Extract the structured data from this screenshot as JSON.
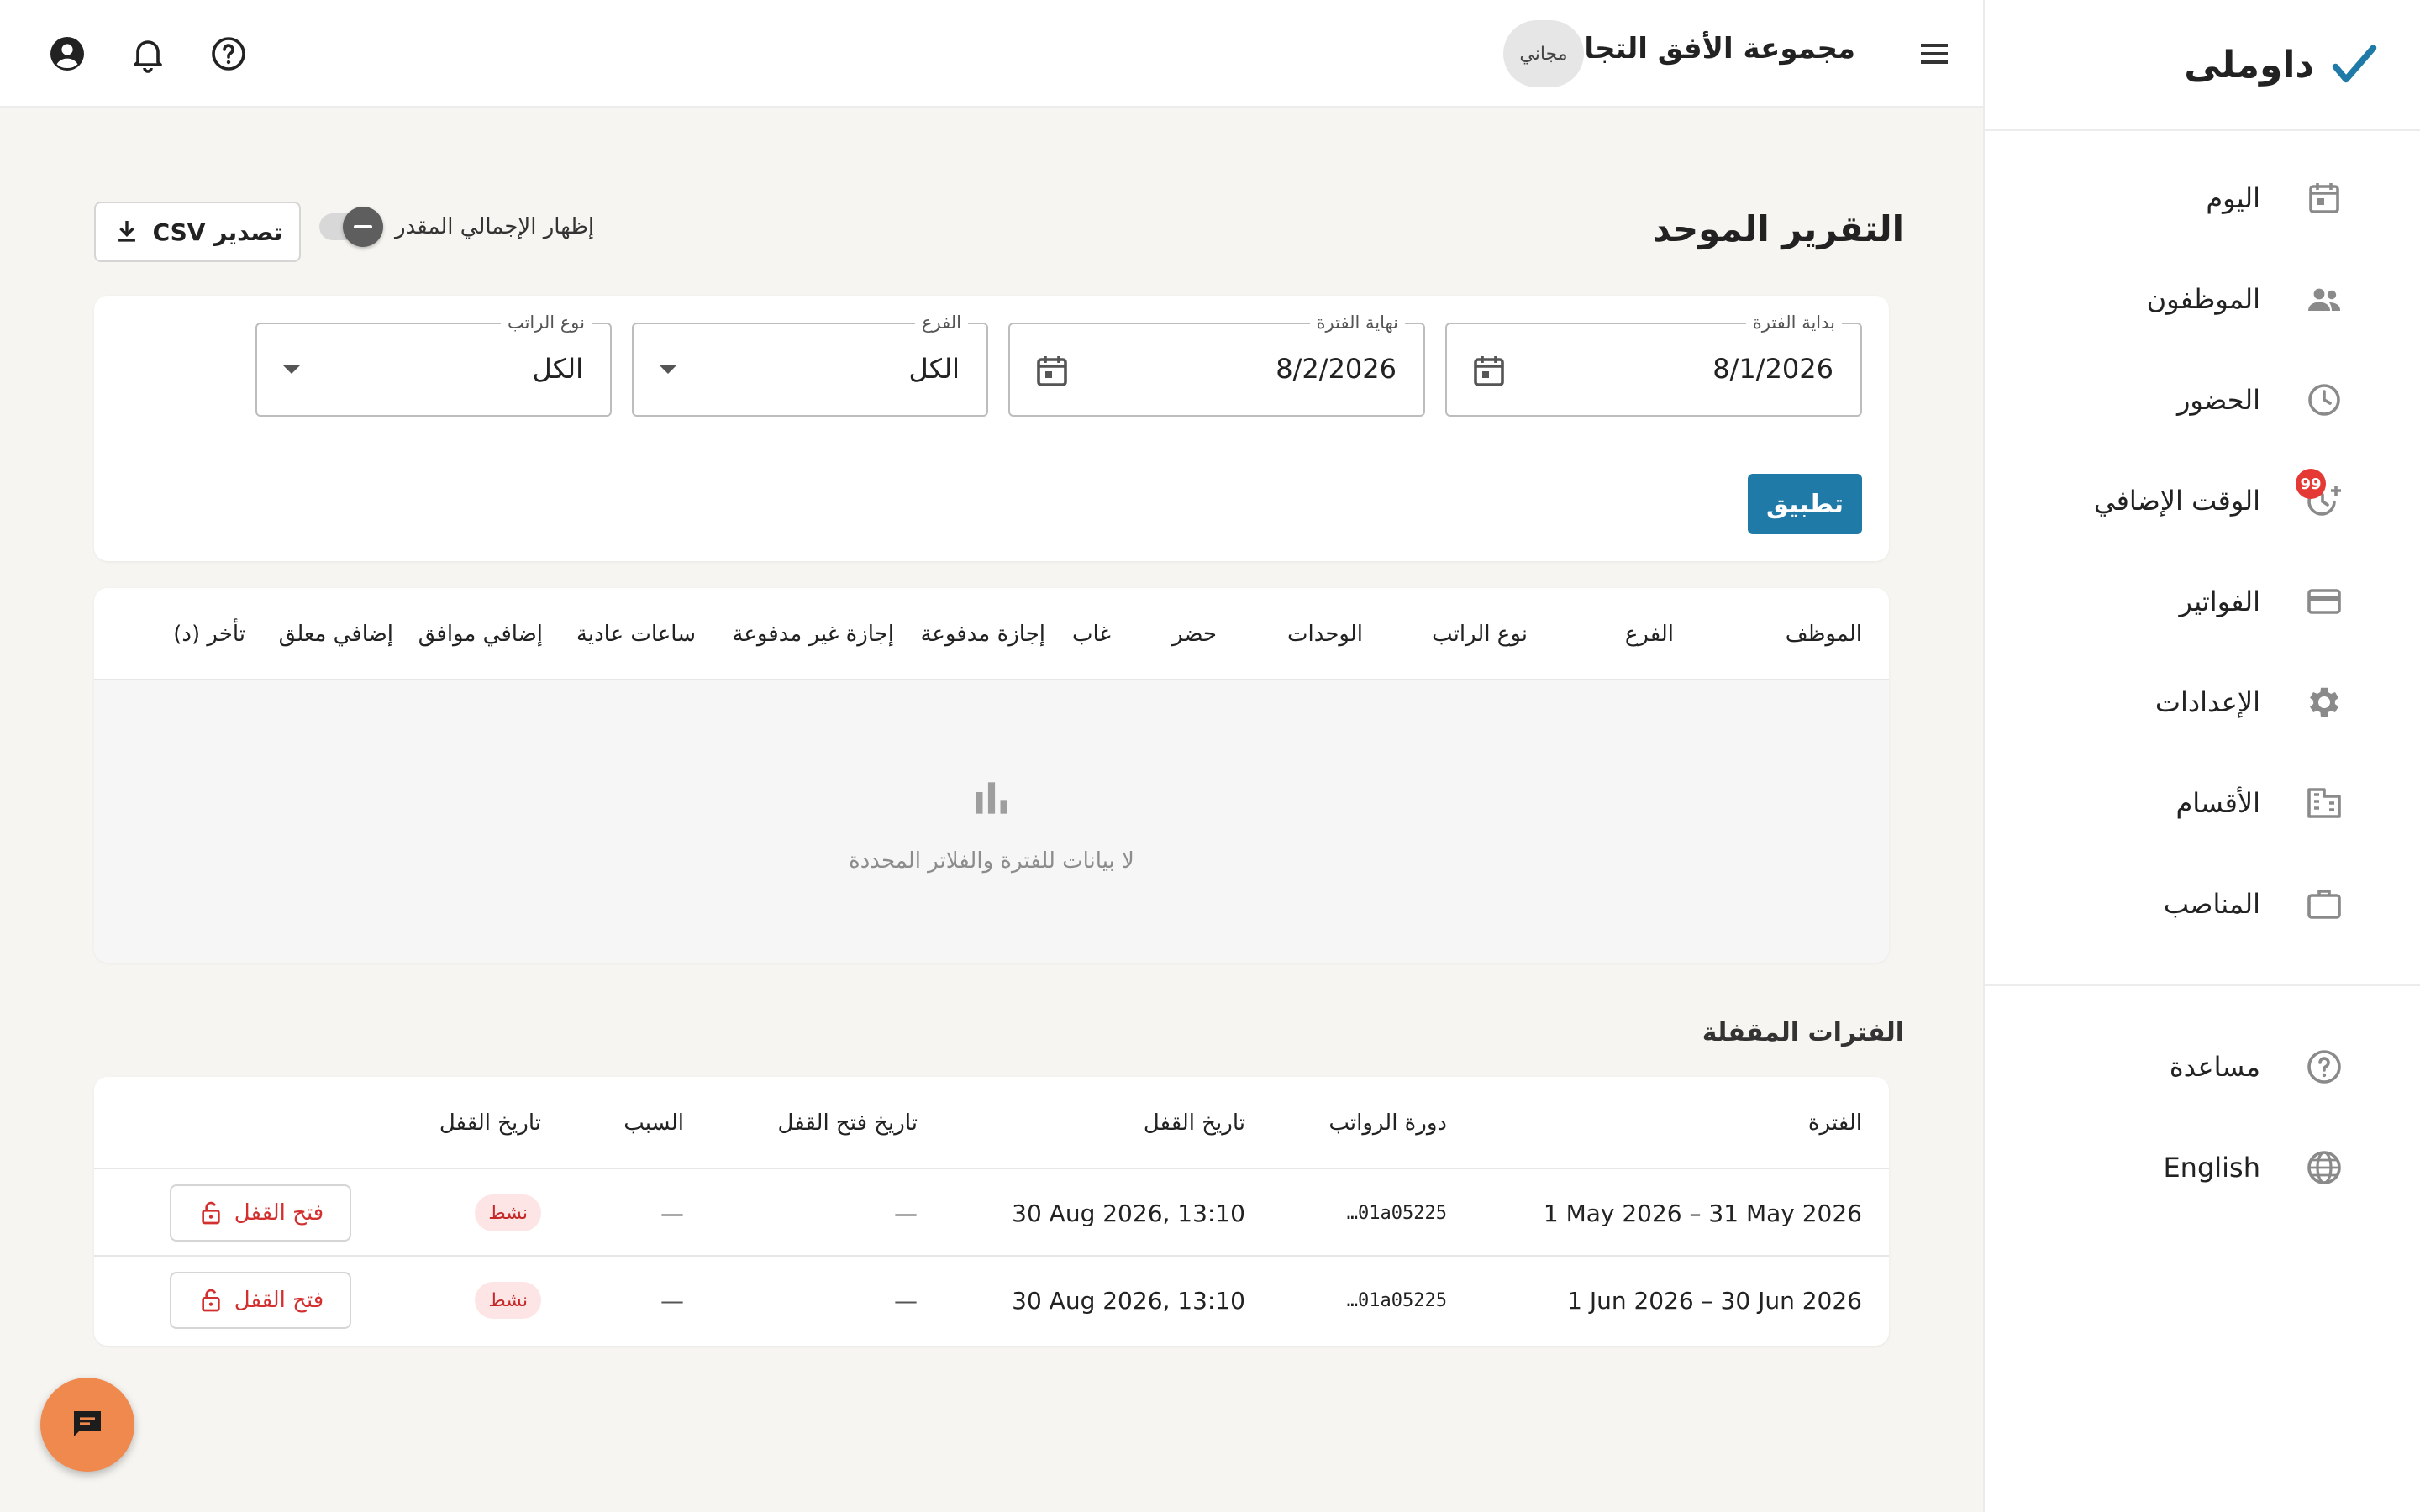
{
  "app": {
    "name": "داوملى"
  },
  "sidebar": {
    "items": [
      {
        "label": "اليوم",
        "icon": "calendar-icon"
      },
      {
        "label": "الموظفون",
        "icon": "people-icon"
      },
      {
        "label": "الحضور",
        "icon": "clock-icon"
      },
      {
        "label": "الوقت الإضافي",
        "icon": "clock-plus-icon",
        "badge": "99"
      },
      {
        "label": "الفواتير",
        "icon": "credit-card-icon"
      },
      {
        "label": "الإعدادات",
        "icon": "gear-icon"
      },
      {
        "label": "الأقسام",
        "icon": "building-icon"
      },
      {
        "label": "المناصب",
        "icon": "briefcase-icon"
      }
    ],
    "footer": [
      {
        "label": "مساعدة",
        "icon": "help-icon"
      },
      {
        "label": "English",
        "icon": "globe-icon"
      }
    ]
  },
  "topbar": {
    "company": "مجموعة الأفق التجارية",
    "plan": "مجاني"
  },
  "page": {
    "title": "التقرير الموحد",
    "toggle_label": "إظهار الإجمالي المقدر",
    "toggle_on": false,
    "export_label": "تصدير CSV"
  },
  "filters": {
    "start": {
      "legend": "بداية الفترة",
      "value": "8/1/2026"
    },
    "end": {
      "legend": "نهاية الفترة",
      "value": "8/2/2026"
    },
    "branch": {
      "legend": "الفرع",
      "value": "الكل"
    },
    "pay_type": {
      "legend": "نوع الراتب",
      "value": "الكل"
    },
    "apply_label": "تطبيق"
  },
  "report": {
    "columns": [
      "الموظف",
      "الفرع",
      "نوع الراتب",
      "الوحدات",
      "حضر",
      "غاب",
      "إجازة مدفوعة",
      "إجازة غير مدفوعة",
      "ساعات عادية",
      "إضافي موافق",
      "إضافي معلق",
      "تأخر (د)"
    ],
    "empty_text": "لا بيانات للفترة والفلاتر المحددة"
  },
  "locked": {
    "title": "الفترات المقفلة",
    "columns": [
      "الفترة",
      "دورة الرواتب",
      "تاريخ القفل",
      "تاريخ فتح القفل",
      "السبب",
      "تاريخ القفل"
    ],
    "rows": [
      {
        "period": "1 May 2026 – 31 May 2026",
        "cycle": "…01a05225",
        "locked_at": "30 Aug 2026, 13:10",
        "unlocked_at": "—",
        "reason": "—",
        "status": "نشط",
        "action": "فتح القفل"
      },
      {
        "period": "1 Jun 2026 – 30 Jun 2026",
        "cycle": "…01a05225",
        "locked_at": "30 Aug 2026, 13:10",
        "unlocked_at": "—",
        "reason": "—",
        "status": "نشط",
        "action": "فتح القفل"
      }
    ]
  },
  "colors": {
    "accent": "#1f7aa8",
    "brand_check": "#1f7aa8",
    "danger": "#d32f2f",
    "chat_fab": "#f0894d"
  }
}
